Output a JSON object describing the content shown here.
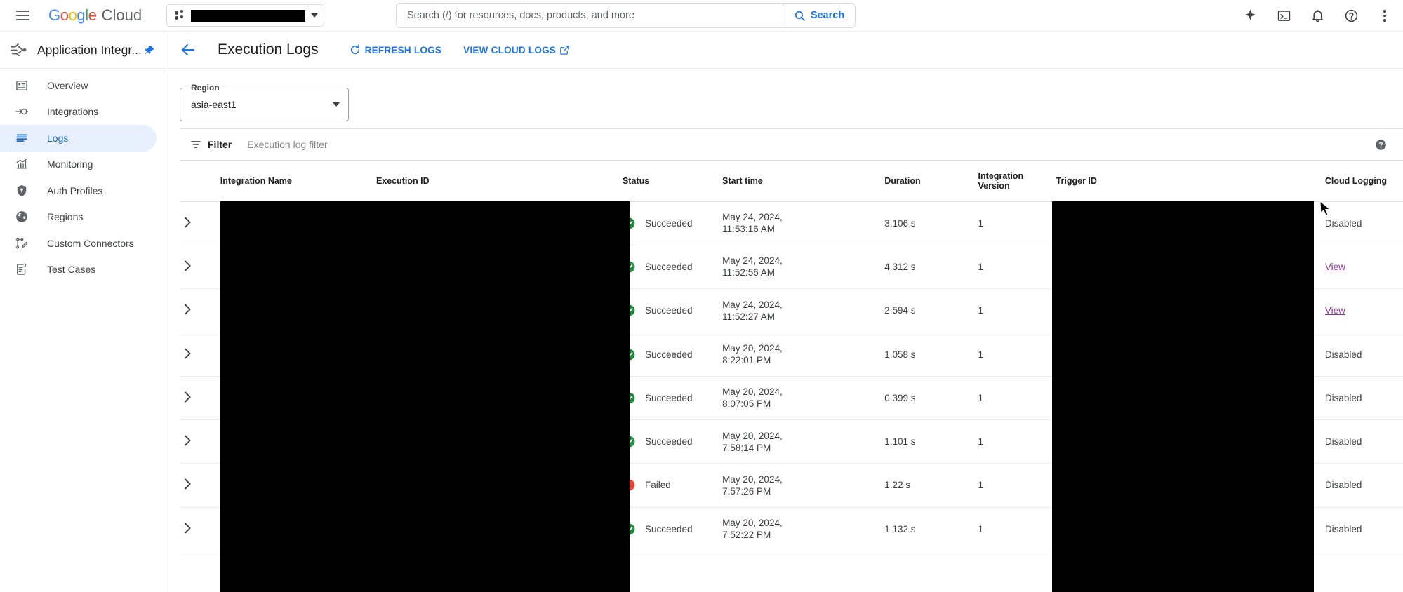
{
  "topbar": {
    "menu_icon": "hamburger-icon",
    "brand": {
      "google": "Google",
      "cloud": "Cloud"
    },
    "project_picker": {
      "icon": "project-dots-icon",
      "value": "",
      "redacted": true
    },
    "search": {
      "placeholder": "Search (/) for resources, docs, products, and more",
      "value": "",
      "button_label": "Search",
      "button_icon": "search-icon",
      "accent": "#1a73e8"
    },
    "icons": [
      {
        "name": "gemini-sparkle-icon",
        "label": "Gemini"
      },
      {
        "name": "cloud-shell-icon",
        "label": "Activate Cloud Shell"
      },
      {
        "name": "notifications-bell-icon",
        "label": "Notifications"
      },
      {
        "name": "help-circle-icon",
        "label": "Help"
      },
      {
        "name": "more-vert-icon",
        "label": "More options"
      }
    ]
  },
  "sidebar": {
    "product_icon": "application-integration-icon",
    "product_title": "Application Integr...",
    "pin_icon": "pin-icon",
    "items": [
      {
        "label": "Overview",
        "icon": "overview-icon",
        "active": false
      },
      {
        "label": "Integrations",
        "icon": "integrations-icon",
        "active": false
      },
      {
        "label": "Logs",
        "icon": "logs-icon",
        "active": true
      },
      {
        "label": "Monitoring",
        "icon": "monitoring-icon",
        "active": false
      },
      {
        "label": "Auth Profiles",
        "icon": "shield-key-icon",
        "active": false
      },
      {
        "label": "Regions",
        "icon": "globe-icon",
        "active": false
      },
      {
        "label": "Custom Connectors",
        "icon": "custom-connectors-icon",
        "active": false
      },
      {
        "label": "Test Cases",
        "icon": "test-cases-icon",
        "active": false
      }
    ],
    "active_bg": "#e8f0fe",
    "active_fg": "#1967d2"
  },
  "page": {
    "back_icon": "back-arrow-icon",
    "title": "Execution Logs",
    "actions": [
      {
        "label": "REFRESH LOGS",
        "icon": "refresh-icon"
      },
      {
        "label": "VIEW CLOUD LOGS",
        "icon": "open-in-new-icon"
      }
    ]
  },
  "region_select": {
    "legend": "Region",
    "value": "asia-east1",
    "caret_icon": "chevron-down-icon"
  },
  "filter": {
    "icon": "filter-funnel-icon",
    "label": "Filter",
    "placeholder": "Execution log filter",
    "value": "",
    "help_icon": "help-circle-icon"
  },
  "table": {
    "columns": [
      {
        "key": "expand",
        "label": ""
      },
      {
        "key": "integration_name",
        "label": "Integration Name"
      },
      {
        "key": "execution_id",
        "label": "Execution ID"
      },
      {
        "key": "status",
        "label": "Status"
      },
      {
        "key": "start_time",
        "label": "Start time"
      },
      {
        "key": "duration",
        "label": "Duration"
      },
      {
        "key": "integration_version",
        "label": "Integration Version"
      },
      {
        "key": "trigger_id",
        "label": "Trigger ID"
      },
      {
        "key": "cloud_logging",
        "label": "Cloud Logging"
      }
    ],
    "rows": [
      {
        "expand_icon": "chevron-right-icon",
        "integration_name": "",
        "execution_id": "",
        "status": "Succeeded",
        "status_icon": "check-circle-icon",
        "date": "May 24, 2024,",
        "time": "11:53:16 AM",
        "duration": "3.106 s",
        "integration_version": "1",
        "trigger_id": "",
        "cloud_logging": "Disabled",
        "cloud_logging_is_link": false
      },
      {
        "expand_icon": "chevron-right-icon",
        "integration_name": "",
        "execution_id": "",
        "status": "Succeeded",
        "status_icon": "check-circle-icon",
        "date": "May 24, 2024,",
        "time": "11:52:56 AM",
        "duration": "4.312 s",
        "integration_version": "1",
        "trigger_id": "",
        "cloud_logging": "View",
        "cloud_logging_is_link": true
      },
      {
        "expand_icon": "chevron-right-icon",
        "integration_name": "",
        "execution_id": "",
        "status": "Succeeded",
        "status_icon": "check-circle-icon",
        "date": "May 24, 2024,",
        "time": "11:52:27 AM",
        "duration": "2.594 s",
        "integration_version": "1",
        "trigger_id": "",
        "cloud_logging": "View",
        "cloud_logging_is_link": true
      },
      {
        "expand_icon": "chevron-right-icon",
        "integration_name": "",
        "execution_id": "",
        "status": "Succeeded",
        "status_icon": "check-circle-icon",
        "date": "May 20, 2024,",
        "time": "8:22:01 PM",
        "duration": "1.058 s",
        "integration_version": "1",
        "trigger_id": "",
        "cloud_logging": "Disabled",
        "cloud_logging_is_link": false
      },
      {
        "expand_icon": "chevron-right-icon",
        "integration_name": "",
        "execution_id": "",
        "status": "Succeeded",
        "status_icon": "check-circle-icon",
        "date": "May 20, 2024,",
        "time": "8:07:05 PM",
        "duration": "0.399 s",
        "integration_version": "1",
        "trigger_id": "",
        "cloud_logging": "Disabled",
        "cloud_logging_is_link": false
      },
      {
        "expand_icon": "chevron-right-icon",
        "integration_name": "",
        "execution_id": "",
        "status": "Succeeded",
        "status_icon": "check-circle-icon",
        "date": "May 20, 2024,",
        "time": "7:58:14 PM",
        "duration": "1.101 s",
        "integration_version": "1",
        "trigger_id": "",
        "cloud_logging": "Disabled",
        "cloud_logging_is_link": false
      },
      {
        "expand_icon": "chevron-right-icon",
        "integration_name": "",
        "execution_id": "",
        "status": "Failed",
        "status_icon": "error-circle-icon",
        "date": "May 20, 2024,",
        "time": "7:57:26 PM",
        "duration": "1.22 s",
        "integration_version": "1",
        "trigger_id": "",
        "cloud_logging": "Disabled",
        "cloud_logging_is_link": false
      },
      {
        "expand_icon": "chevron-right-icon",
        "integration_name": "",
        "execution_id": "",
        "status": "Succeeded",
        "status_icon": "check-circle-icon",
        "date": "May 20, 2024,",
        "time": "7:52:22 PM",
        "duration": "1.132 s",
        "integration_version": "1",
        "trigger_id": "",
        "cloud_logging": "Disabled",
        "cloud_logging_is_link": false
      }
    ],
    "status_colors": {
      "succeeded": "#1e8e3e",
      "failed": "#ea4335"
    },
    "link_color": "#9334a0"
  },
  "cursor": {
    "icon": "mouse-pointer-icon"
  }
}
